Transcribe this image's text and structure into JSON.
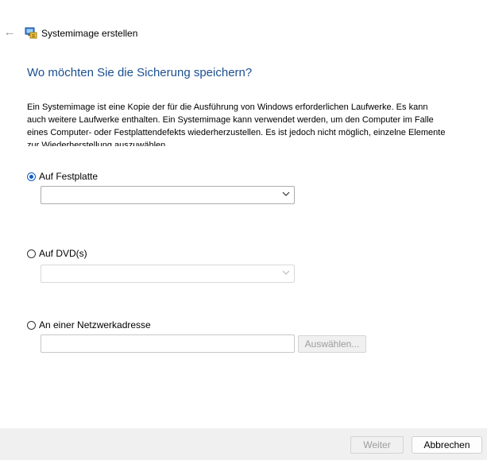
{
  "header": {
    "back_icon": "arrow-left-icon",
    "app_icon": "system-image-backup-icon",
    "title": "Systemimage erstellen"
  },
  "main": {
    "heading": "Wo möchten Sie die Sicherung speichern?",
    "description": "Ein Systemimage ist eine Kopie der für die Ausführung von Windows erforderlichen Laufwerke. Es kann auch weitere Laufwerke enthalten. Ein Systemimage kann verwendet werden, um den Computer im Falle eines Computer- oder Festplattendefekts wiederherzustellen. Es ist jedoch nicht möglich, einzelne Elemente zur Wiederherstellung auszuwählen.",
    "options": {
      "harddisk": {
        "label": "Auf Festplatte",
        "selected": true,
        "value": ""
      },
      "dvd": {
        "label": "Auf DVD(s)",
        "selected": false,
        "value": ""
      },
      "network": {
        "label": "An einer Netzwerkadresse",
        "selected": false,
        "value": "",
        "browse_label": "Auswählen..."
      }
    }
  },
  "footer": {
    "next_label": "Weiter",
    "cancel_label": "Abbrechen"
  },
  "colors": {
    "heading": "#1b4f8f",
    "accent": "#0a5cc4",
    "footer_bg": "#f0f0f0"
  }
}
